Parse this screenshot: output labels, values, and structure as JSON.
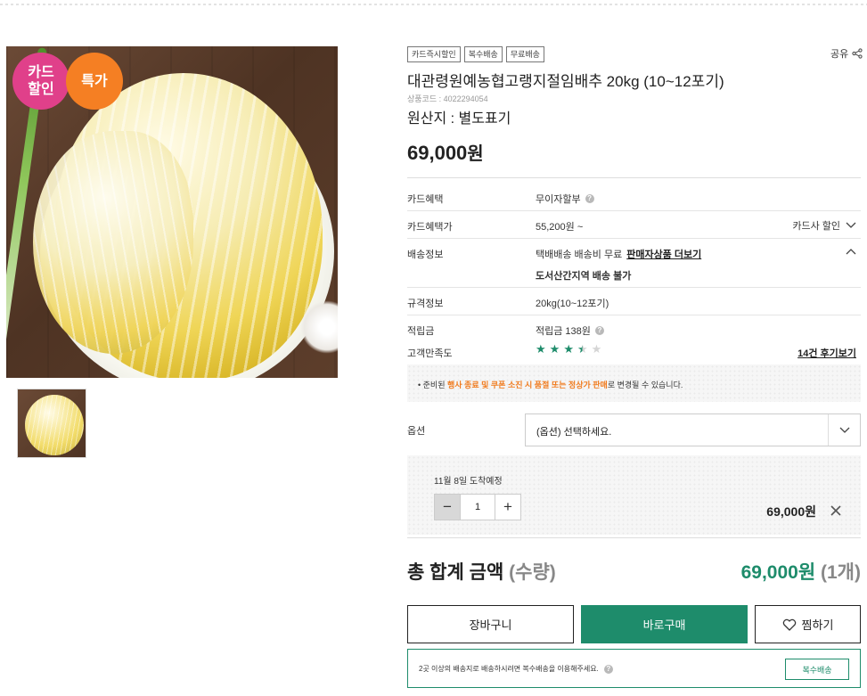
{
  "badges": {
    "card_discount": "카드\n할인",
    "special_price": "특가"
  },
  "tags": [
    "카드즉시할인",
    "복수배송",
    "무료배송"
  ],
  "share_label": "공유",
  "product": {
    "title": "대관령원예농협고랭지절임배추 20kg (10~12포기)",
    "code_label": "상품코드 : 4022294054",
    "origin": "원산지 : 별도표기",
    "price_number": "69,000",
    "price_unit": "원"
  },
  "info": {
    "card_benefit": {
      "label": "카드혜택",
      "value": "무이자할부"
    },
    "card_price": {
      "label": "카드혜택가",
      "value": "55,200원 ~",
      "right_label": "카드사 할인"
    },
    "shipping": {
      "label": "배송정보",
      "value_prefix": "택배배송 배송비 무료",
      "seller_link": "판매자상품 더보기",
      "restriction": "도서산간지역 배송 불가"
    },
    "spec": {
      "label": "규격정보",
      "value": "20kg(10~12포기)"
    },
    "points": {
      "label": "적립금",
      "value": "적립금 138원"
    },
    "satisfaction": {
      "label": "고객만족도",
      "rating": 3.5,
      "max": 5,
      "reviews_link": "14건 후기보기"
    }
  },
  "notice": {
    "prefix": "• 준비된 ",
    "highlight": "행사 종료 및 쿠폰 소진 시 품절 또는 정상가 판매",
    "suffix": "로 변경될 수 있습니다."
  },
  "option": {
    "label": "옵션",
    "placeholder": "(옵션) 선택하세요."
  },
  "selected": {
    "arrival": "11월 8일 도착예정",
    "quantity": "1",
    "line_price": "69,000원"
  },
  "total": {
    "label": "총 합계 금액",
    "label_sub": "(수량)",
    "amount": "69,000원",
    "count": "(1개)"
  },
  "actions": {
    "cart": "장바구니",
    "buy": "바로구매",
    "wish": "찜하기"
  },
  "multi_shipping": {
    "message": "2곳 이상의 배송지로 배송하시려면 복수배송을 이용해주세요.",
    "button": "복수배송"
  },
  "colors": {
    "accent": "#1e8c6b",
    "highlight": "#f07b1e",
    "badge_card": "#e0408a",
    "badge_special": "#f57f23"
  }
}
